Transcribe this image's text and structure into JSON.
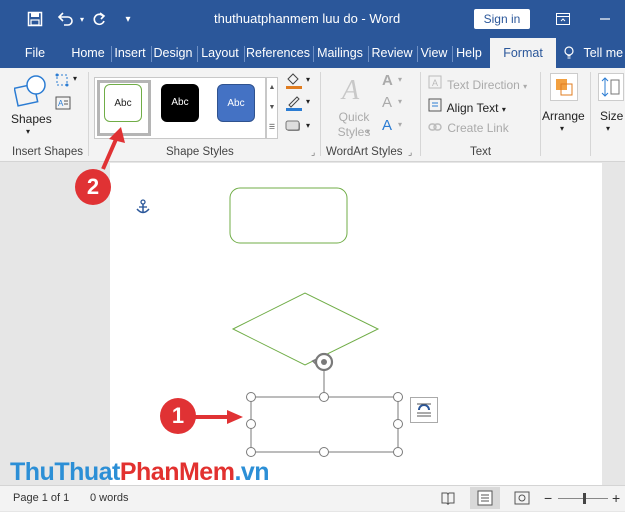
{
  "window": {
    "title": "thuthuatphanmem luu do  -  Word",
    "signin_label": "Sign in"
  },
  "tabs": [
    "File",
    "Home",
    "Insert",
    "Design",
    "Layout",
    "References",
    "Mailings",
    "Review",
    "View",
    "Help",
    "Format"
  ],
  "active_tab": "Format",
  "tell_me": "Tell me",
  "ribbon": {
    "shapes_label": "Shapes",
    "insert_shapes_label": "Insert Shapes",
    "shape_styles_label": "Shape Styles",
    "style_samples": [
      "Abc",
      "Abc",
      "Abc"
    ],
    "quick_styles_label": "Quick Styles",
    "wordart_label": "WordArt Styles",
    "text_direction": "Text Direction",
    "align_text": "Align Text",
    "create_link": "Create Link",
    "text_group_label": "Text",
    "arrange_label": "Arrange",
    "size_label": "Size"
  },
  "callouts": [
    "1",
    "2"
  ],
  "status": {
    "page": "Page 1 of 1",
    "words": "0 words"
  },
  "watermark": {
    "part1": "ThuThuat",
    "part2": "PhanMem",
    "part3": ".vn"
  },
  "colors": {
    "word_blue": "#2b579a",
    "shape_green": "#70ad47",
    "badge_red": "#e03234"
  }
}
